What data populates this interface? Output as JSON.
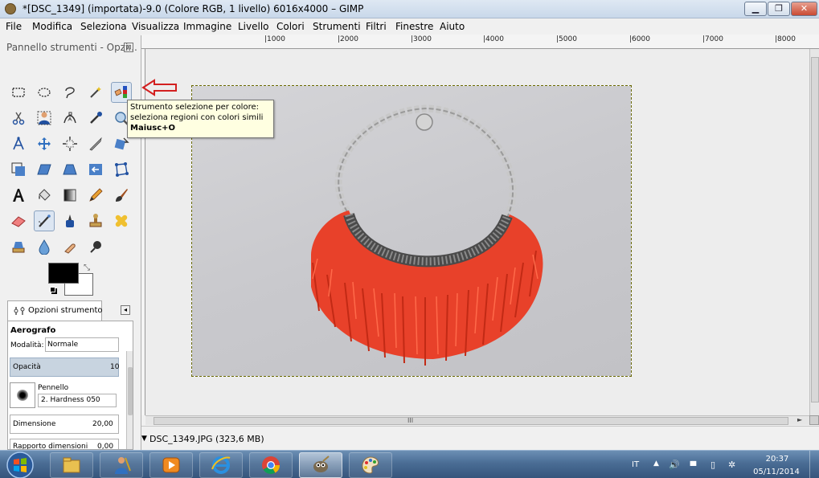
{
  "window": {
    "title": "*[DSC_1349] (importata)-9.0 (Colore RGB, 1 livello) 6016x4000 – GIMP",
    "minimize": "▁",
    "maximize": "❐",
    "close": "✕"
  },
  "menubar": [
    "File",
    "Modifica",
    "Seleziona",
    "Visualizza",
    "Immagine",
    "Livello",
    "Colori",
    "Strumenti",
    "Filtri",
    "Finestre",
    "Aiuto"
  ],
  "toolbox": {
    "title": "Pannello strumenti - Opzi...",
    "close": "⊠",
    "tools": [
      "rect-select",
      "ellipse-select",
      "free-select",
      "fuzzy-select",
      "select-by-color",
      "scissors",
      "foreground-select",
      "paths",
      "color-picker",
      "zoom",
      "measure",
      "move",
      "align",
      "crop",
      "rotate",
      "scale",
      "shear",
      "perspective",
      "flip",
      "cage-transform",
      "text",
      "bucket-fill",
      "blend",
      "pencil",
      "paintbrush",
      "eraser",
      "airbrush",
      "ink",
      "clone",
      "heal",
      "perspective-clone",
      "blur-sharpen",
      "smudge",
      "dodge-burn"
    ],
    "active_tool": "airbrush",
    "swap_glyph": "⤡"
  },
  "tooltip": {
    "line1": "Strumento selezione per colore:",
    "line2": "seleziona regioni con colori simili",
    "shortcut": "Maiusc+O"
  },
  "tool_options": {
    "tab_label": "Opzioni strumento",
    "menu_glyph": "◂",
    "tool_name": "Aerografo",
    "mode_label": "Modalità:",
    "mode_value": "Normale",
    "opacity_label": "Opacità",
    "opacity_value": "10",
    "brush_label": "Pennello",
    "brush_name": "2. Hardness 050",
    "size_label": "Dimensione",
    "size_value": "20,00",
    "ratio_label": "Rapporto dimensioni",
    "ratio_value": "0,00"
  },
  "ruler": {
    "labels": [
      "|1000",
      "|2000",
      "|3000",
      "|4000",
      "|5000",
      "|6000",
      "|7000",
      "|8000"
    ]
  },
  "scroll": {
    "grip": "III",
    "arrow": "►"
  },
  "statusbar": {
    "arrow": "▼",
    "text": "DSC_1349.JPG (323,6 MB)"
  },
  "taskbar": {
    "apps": [
      "windows-explorer",
      "paint-tool",
      "media-player",
      "internet-explorer",
      "chrome",
      "gimp",
      "paint"
    ],
    "active_app": "gimp",
    "lang": "IT",
    "tray_expand": "▲",
    "tray_flag": "⚑",
    "tray_volume": "🔊",
    "tray_network": "▮▮▮",
    "tray_battery": "▯",
    "tray_update": "✲",
    "time": "20:37",
    "date": "05/11/2014"
  },
  "colors": {
    "foreground": "#000000",
    "background": "#ffffff",
    "annotation_arrow": "#d32020",
    "necklace_beads": "#e8412a",
    "taskbar": "#4a6d95"
  }
}
